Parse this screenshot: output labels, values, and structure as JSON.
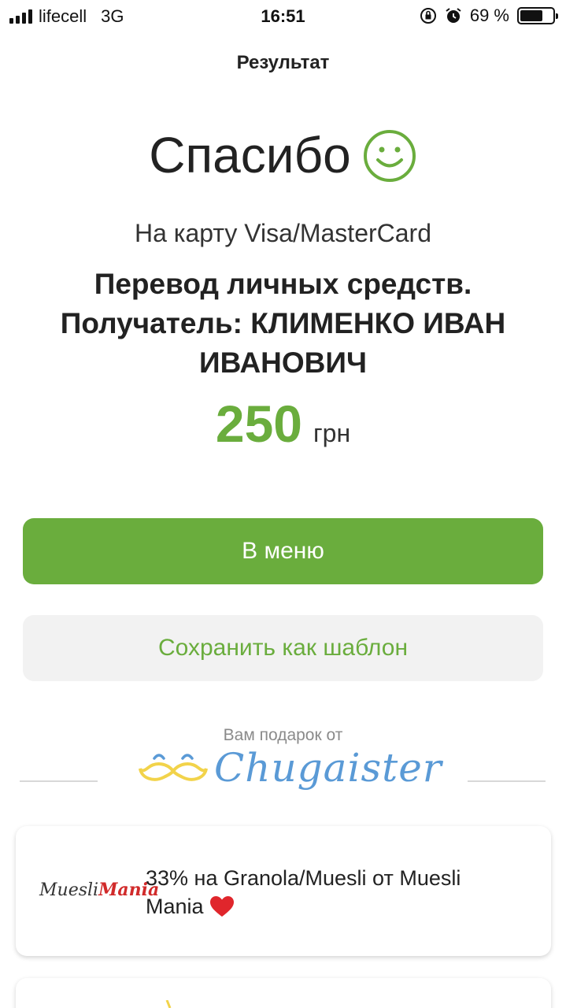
{
  "status_bar": {
    "carrier": "lifecell",
    "network": "3G",
    "time": "16:51",
    "battery": "69 %",
    "battery_level": 0.69
  },
  "nav": {
    "title": "Результат"
  },
  "result": {
    "thanks": "Спасибо",
    "subtitle": "На карту Visa/MasterCard",
    "description": "Перевод личных средств. Получатель: КЛИМЕНКО ИВАН ИВАНОВИЧ",
    "amount": "250",
    "currency": "грн"
  },
  "buttons": {
    "menu": "В меню",
    "save_template": "Сохранить как шаблон"
  },
  "gift": {
    "label": "Вам подарок от",
    "brand": "Chugaister"
  },
  "offers": [
    {
      "logo_text": "Muesli",
      "logo_text_accent": "Mania",
      "text": "33% на Granola/Muesli от Muesli Mania",
      "emoji_icon": "heart-icon"
    }
  ],
  "colors": {
    "accent": "#6aad3d",
    "brand_blue": "#5a9ad6",
    "mustache_yellow": "#f2d34a",
    "heart_red": "#e0262c"
  }
}
